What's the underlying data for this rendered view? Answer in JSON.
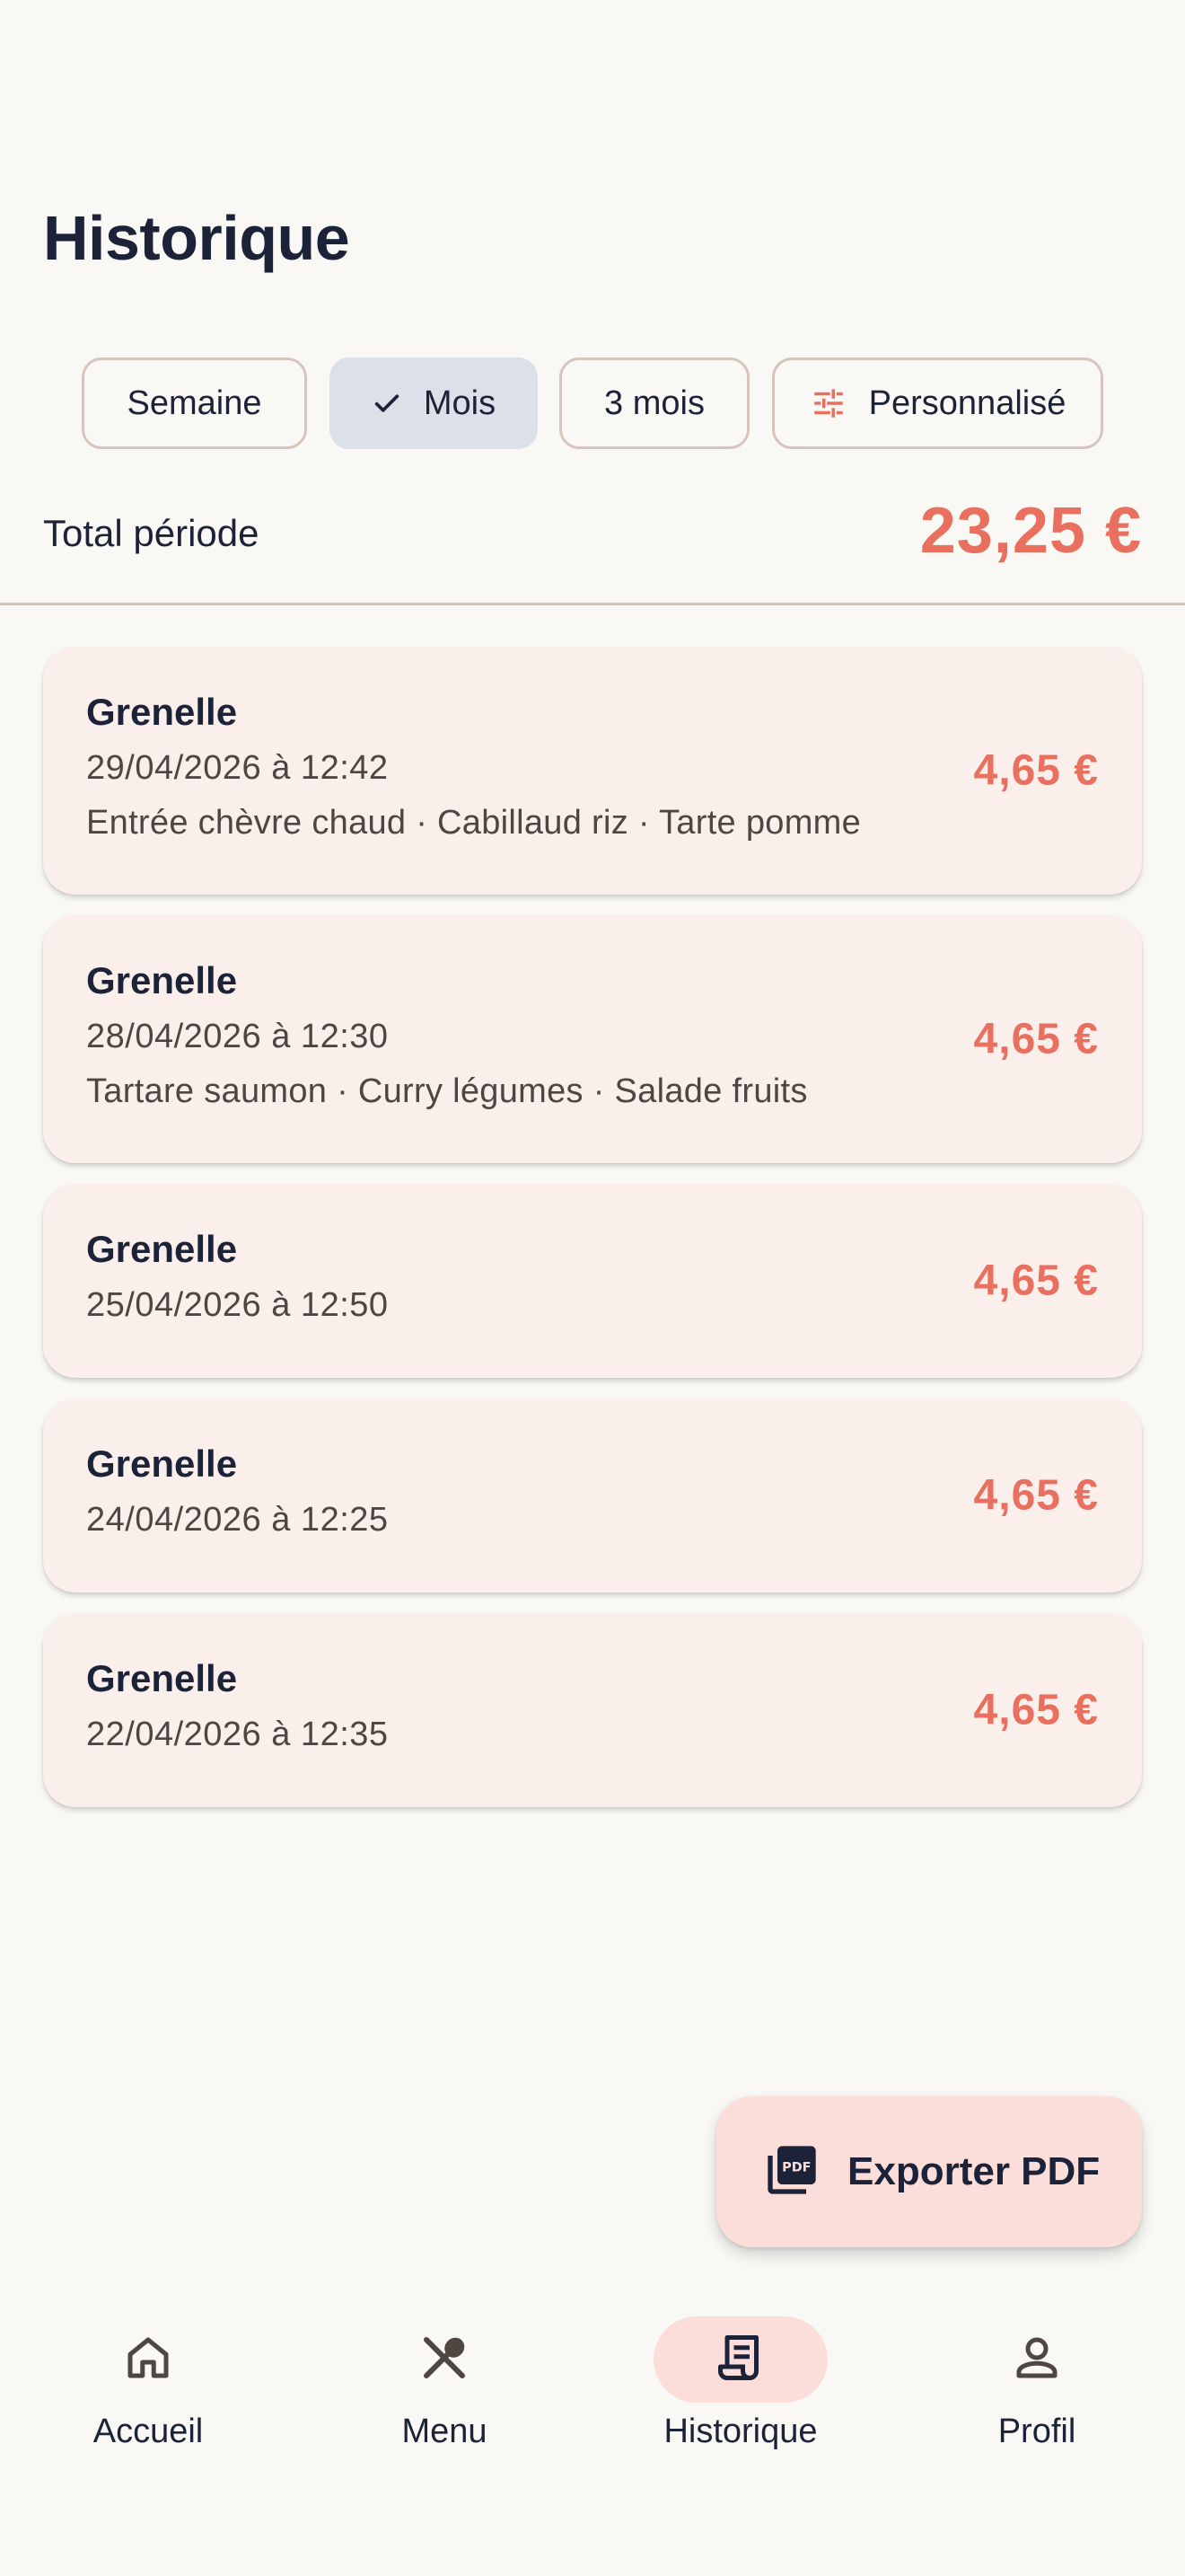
{
  "page": {
    "title": "Historique"
  },
  "filters": {
    "chips": [
      {
        "label": "Semaine",
        "selected": false,
        "icon": ""
      },
      {
        "label": "Mois",
        "selected": true,
        "icon": "check-icon"
      },
      {
        "label": "3 mois",
        "selected": false,
        "icon": ""
      },
      {
        "label": "Personnalisé",
        "selected": false,
        "icon": "tune-icon"
      }
    ]
  },
  "total": {
    "label": "Total période",
    "value": "23,25 €"
  },
  "transactions": [
    {
      "restaurant": "Grenelle",
      "datetime": "29/04/2026 à 12:42",
      "items": "Entrée chèvre chaud · Cabillaud riz · Tarte pomme",
      "amount": "4,65 €"
    },
    {
      "restaurant": "Grenelle",
      "datetime": "28/04/2026 à 12:30",
      "items": "Tartare saumon · Curry légumes · Salade fruits",
      "amount": "4,65 €"
    },
    {
      "restaurant": "Grenelle",
      "datetime": "25/04/2026 à 12:50",
      "items": "",
      "amount": "4,65 €"
    },
    {
      "restaurant": "Grenelle",
      "datetime": "24/04/2026 à 12:25",
      "items": "",
      "amount": "4,65 €"
    },
    {
      "restaurant": "Grenelle",
      "datetime": "22/04/2026 à 12:35",
      "items": "",
      "amount": "4,65 €"
    }
  ],
  "fab": {
    "label": "Exporter PDF",
    "icon": "pdf-icon"
  },
  "nav": {
    "items": [
      {
        "label": "Accueil",
        "icon": "home-icon",
        "active": false
      },
      {
        "label": "Menu",
        "icon": "restaurant-icon",
        "active": false
      },
      {
        "label": "Historique",
        "icon": "receipt-icon",
        "active": true
      },
      {
        "label": "Profil",
        "icon": "person-icon",
        "active": false
      }
    ]
  },
  "colors": {
    "background": "#f9f8f4",
    "accent": "#e9705f",
    "card": "#fbefec",
    "selected_chip": "#dce0e9",
    "fab": "#fbdeda",
    "text": "#1c2238"
  }
}
